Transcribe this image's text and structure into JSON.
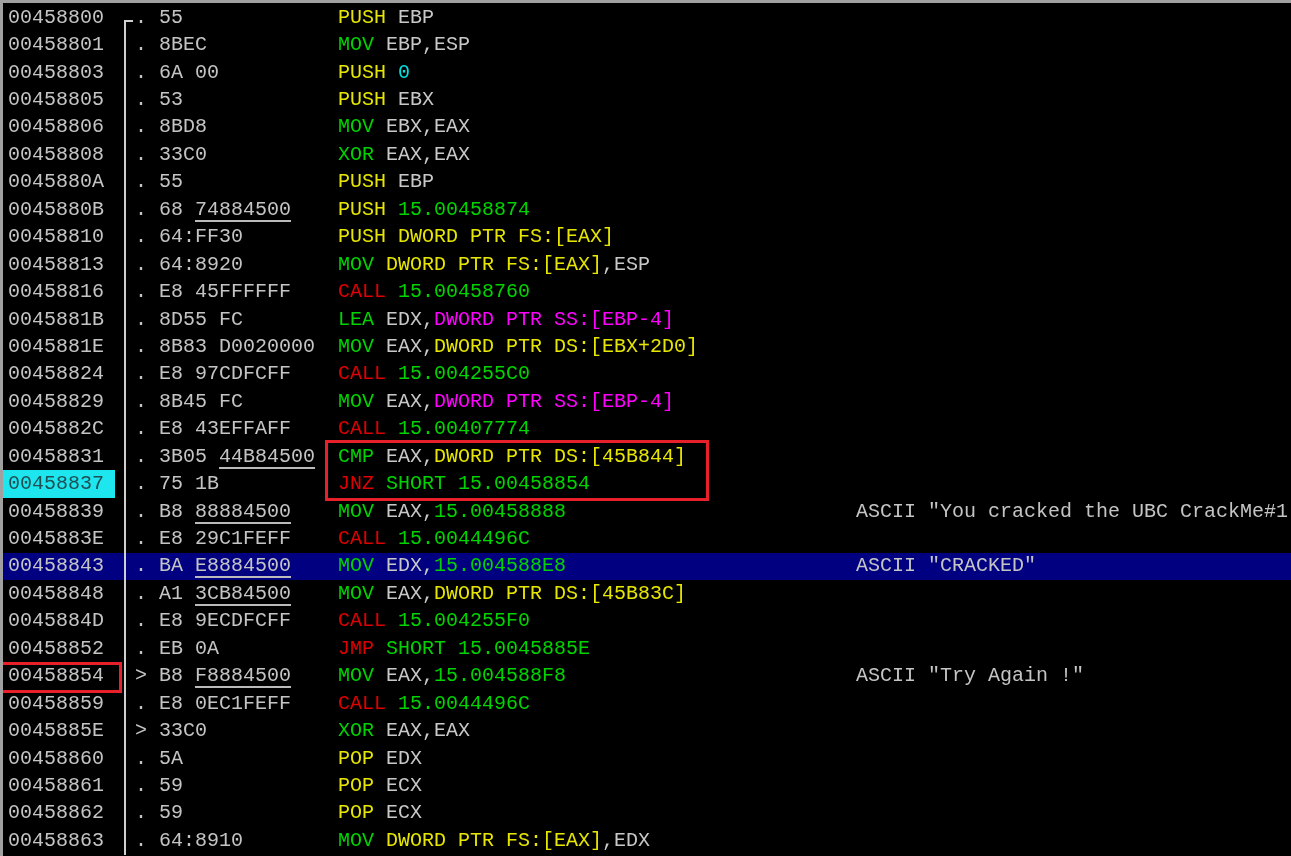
{
  "rows": [
    {
      "address": "00458800",
      "marker": ".",
      "hex": "55",
      "mnemonic": "PUSH",
      "kind": "push",
      "operands": [
        {
          "text": "EBP",
          "kind": "reg"
        }
      ],
      "selected": false,
      "current": false,
      "address_boxed": false,
      "asm_boxed": false
    },
    {
      "address": "00458801",
      "marker": ".",
      "hex": "8BEC",
      "mnemonic": "MOV",
      "kind": "move",
      "operands": [
        {
          "text": "EBP,ESP",
          "kind": "reg"
        }
      ],
      "selected": false,
      "current": false,
      "address_boxed": false,
      "asm_boxed": false
    },
    {
      "address": "00458803",
      "marker": ".",
      "hex": "6A 00",
      "mnemonic": "PUSH",
      "kind": "push",
      "operands": [
        {
          "text": "0",
          "kind": "imm"
        }
      ],
      "selected": false,
      "current": false,
      "address_boxed": false,
      "asm_boxed": false
    },
    {
      "address": "00458805",
      "marker": ".",
      "hex": "53",
      "mnemonic": "PUSH",
      "kind": "push",
      "operands": [
        {
          "text": "EBX",
          "kind": "reg"
        }
      ],
      "selected": false,
      "current": false,
      "address_boxed": false,
      "asm_boxed": false
    },
    {
      "address": "00458806",
      "marker": ".",
      "hex": "8BD8",
      "mnemonic": "MOV",
      "kind": "move",
      "operands": [
        {
          "text": "EBX,EAX",
          "kind": "reg"
        }
      ],
      "selected": false,
      "current": false,
      "address_boxed": false,
      "asm_boxed": false
    },
    {
      "address": "00458808",
      "marker": ".",
      "hex": "33C0",
      "mnemonic": "XOR",
      "kind": "move",
      "operands": [
        {
          "text": "EAX,EAX",
          "kind": "reg"
        }
      ],
      "selected": false,
      "current": false,
      "address_boxed": false,
      "asm_boxed": false
    },
    {
      "address": "0045880A",
      "marker": ".",
      "hex": "55",
      "mnemonic": "PUSH",
      "kind": "push",
      "operands": [
        {
          "text": "EBP",
          "kind": "reg"
        }
      ],
      "selected": false,
      "current": false,
      "address_boxed": false,
      "asm_boxed": false
    },
    {
      "address": "0045880B",
      "marker": ".",
      "hex": "68",
      "hex_ref": "74884500",
      "mnemonic": "PUSH",
      "kind": "push",
      "operands": [
        {
          "text": "15.00458874",
          "kind": "address"
        }
      ],
      "selected": false,
      "current": false,
      "address_boxed": false,
      "asm_boxed": false
    },
    {
      "address": "00458810",
      "marker": ".",
      "hex": "64:FF30",
      "mnemonic": "PUSH",
      "kind": "push",
      "operands": [
        {
          "text": "DWORD PTR FS:[EAX]",
          "kind": "mem"
        }
      ],
      "selected": false,
      "current": false,
      "address_boxed": false,
      "asm_boxed": false
    },
    {
      "address": "00458813",
      "marker": ".",
      "hex": "64:8920",
      "mnemonic": "MOV",
      "kind": "move",
      "operands": [
        {
          "text": "DWORD PTR FS:[EAX]",
          "kind": "mem"
        },
        {
          "text": ",ESP",
          "kind": "reg"
        }
      ],
      "selected": false,
      "current": false,
      "address_boxed": false,
      "asm_boxed": false
    },
    {
      "address": "00458816",
      "marker": ".",
      "hex": "E8 45FFFFFF",
      "mnemonic": "CALL",
      "kind": "call",
      "operands": [
        {
          "text": "15.00458760",
          "kind": "address"
        }
      ],
      "selected": false,
      "current": false,
      "address_boxed": false,
      "asm_boxed": false
    },
    {
      "address": "0045881B",
      "marker": ".",
      "hex": "8D55 FC",
      "mnemonic": "LEA",
      "kind": "move",
      "operands": [
        {
          "text": "EDX,",
          "kind": "reg"
        },
        {
          "text": "DWORD PTR SS:[EBP-4]",
          "kind": "stack"
        }
      ],
      "selected": false,
      "current": false,
      "address_boxed": false,
      "asm_boxed": false
    },
    {
      "address": "0045881E",
      "marker": ".",
      "hex": "8B83 D0020000",
      "mnemonic": "MOV",
      "kind": "move",
      "operands": [
        {
          "text": "EAX,",
          "kind": "reg"
        },
        {
          "text": "DWORD PTR DS:[EBX+2D0]",
          "kind": "mem"
        }
      ],
      "selected": false,
      "current": false,
      "address_boxed": false,
      "asm_boxed": false
    },
    {
      "address": "00458824",
      "marker": ".",
      "hex": "E8 97CDFCFF",
      "mnemonic": "CALL",
      "kind": "call",
      "operands": [
        {
          "text": "15.004255C0",
          "kind": "address"
        }
      ],
      "selected": false,
      "current": false,
      "address_boxed": false,
      "asm_boxed": false
    },
    {
      "address": "00458829",
      "marker": ".",
      "hex": "8B45 FC",
      "mnemonic": "MOV",
      "kind": "move",
      "operands": [
        {
          "text": "EAX,",
          "kind": "reg"
        },
        {
          "text": "DWORD PTR SS:[EBP-4]",
          "kind": "stack"
        }
      ],
      "selected": false,
      "current": false,
      "address_boxed": false,
      "asm_boxed": false
    },
    {
      "address": "0045882C",
      "marker": ".",
      "hex": "E8 43EFFAFF",
      "mnemonic": "CALL",
      "kind": "call",
      "operands": [
        {
          "text": "15.00407774",
          "kind": "address"
        }
      ],
      "selected": false,
      "current": false,
      "address_boxed": false,
      "asm_boxed": false
    },
    {
      "address": "00458831",
      "marker": ".",
      "hex": "3B05",
      "hex_ref": "44B84500",
      "mnemonic": "CMP",
      "kind": "move",
      "operands": [
        {
          "text": "EAX,",
          "kind": "reg"
        },
        {
          "text": "DWORD PTR DS:[45B844]",
          "kind": "mem"
        }
      ],
      "selected": false,
      "current": false,
      "address_boxed": false,
      "asm_boxed": true
    },
    {
      "address": "00458837",
      "marker": ".",
      "hex": "75 1B",
      "mnemonic": "JNZ",
      "kind": "call",
      "operands": [
        {
          "text": "SHORT 15.00458854",
          "kind": "address"
        }
      ],
      "selected": false,
      "current": true,
      "address_boxed": false,
      "asm_boxed": true
    },
    {
      "address": "00458839",
      "marker": ".",
      "hex": "B8",
      "hex_ref": "88884500",
      "mnemonic": "MOV",
      "kind": "move",
      "operands": [
        {
          "text": "EAX,",
          "kind": "reg"
        },
        {
          "text": "15.00458888",
          "kind": "address"
        }
      ],
      "comment": "ASCII \"You cracked the UBC CrackMe#1",
      "selected": false,
      "current": false,
      "address_boxed": false,
      "asm_boxed": false
    },
    {
      "address": "0045883E",
      "marker": ".",
      "hex": "E8 29C1FEFF",
      "mnemonic": "CALL",
      "kind": "call",
      "operands": [
        {
          "text": "15.0044496C",
          "kind": "address"
        }
      ],
      "selected": false,
      "current": false,
      "address_boxed": false,
      "asm_boxed": false
    },
    {
      "address": "00458843",
      "marker": ".",
      "hex": "BA",
      "hex_ref": "E8884500",
      "mnemonic": "MOV",
      "kind": "move",
      "operands": [
        {
          "text": "EDX,",
          "kind": "reg"
        },
        {
          "text": "15.004588E8",
          "kind": "address"
        }
      ],
      "comment": "ASCII \"CRACKED\"",
      "selected": true,
      "current": false,
      "address_boxed": false,
      "asm_boxed": false
    },
    {
      "address": "00458848",
      "marker": ".",
      "hex": "A1",
      "hex_ref": "3CB84500",
      "mnemonic": "MOV",
      "kind": "move",
      "operands": [
        {
          "text": "EAX,",
          "kind": "reg"
        },
        {
          "text": "DWORD PTR DS:[45B83C]",
          "kind": "mem"
        }
      ],
      "selected": false,
      "current": false,
      "address_boxed": false,
      "asm_boxed": false
    },
    {
      "address": "0045884D",
      "marker": ".",
      "hex": "E8 9ECDFCFF",
      "mnemonic": "CALL",
      "kind": "call",
      "operands": [
        {
          "text": "15.004255F0",
          "kind": "address"
        }
      ],
      "selected": false,
      "current": false,
      "address_boxed": false,
      "asm_boxed": false
    },
    {
      "address": "00458852",
      "marker": ".",
      "hex": "EB 0A",
      "mnemonic": "JMP",
      "kind": "call",
      "operands": [
        {
          "text": "SHORT 15.0045885E",
          "kind": "address"
        }
      ],
      "selected": false,
      "current": false,
      "address_boxed": false,
      "asm_boxed": false
    },
    {
      "address": "00458854",
      "marker": ">",
      "hex": "B8",
      "hex_ref": "F8884500",
      "mnemonic": "MOV",
      "kind": "move",
      "operands": [
        {
          "text": "EAX,",
          "kind": "reg"
        },
        {
          "text": "15.004588F8",
          "kind": "address"
        }
      ],
      "comment": "ASCII \"Try Again !\"",
      "selected": false,
      "current": false,
      "address_boxed": true,
      "asm_boxed": false
    },
    {
      "address": "00458859",
      "marker": ".",
      "hex": "E8 0EC1FEFF",
      "mnemonic": "CALL",
      "kind": "call",
      "operands": [
        {
          "text": "15.0044496C",
          "kind": "address"
        }
      ],
      "selected": false,
      "current": false,
      "address_boxed": false,
      "asm_boxed": false
    },
    {
      "address": "0045885E",
      "marker": ">",
      "hex": "33C0",
      "mnemonic": "XOR",
      "kind": "move",
      "operands": [
        {
          "text": "EAX,EAX",
          "kind": "reg"
        }
      ],
      "selected": false,
      "current": false,
      "address_boxed": false,
      "asm_boxed": false
    },
    {
      "address": "00458860",
      "marker": ".",
      "hex": "5A",
      "mnemonic": "POP",
      "kind": "push",
      "operands": [
        {
          "text": "EDX",
          "kind": "reg"
        }
      ],
      "selected": false,
      "current": false,
      "address_boxed": false,
      "asm_boxed": false
    },
    {
      "address": "00458861",
      "marker": ".",
      "hex": "59",
      "mnemonic": "POP",
      "kind": "push",
      "operands": [
        {
          "text": "ECX",
          "kind": "reg"
        }
      ],
      "selected": false,
      "current": false,
      "address_boxed": false,
      "asm_boxed": false
    },
    {
      "address": "00458862",
      "marker": ".",
      "hex": "59",
      "mnemonic": "POP",
      "kind": "push",
      "operands": [
        {
          "text": "ECX",
          "kind": "reg"
        }
      ],
      "selected": false,
      "current": false,
      "address_boxed": false,
      "asm_boxed": false
    },
    {
      "address": "00458863",
      "marker": ".",
      "hex": "64:8910",
      "mnemonic": "MOV",
      "kind": "move",
      "operands": [
        {
          "text": "DWORD PTR FS:[EAX]",
          "kind": "mem"
        },
        {
          "text": ",EDX",
          "kind": "reg"
        }
      ],
      "selected": false,
      "current": false,
      "address_boxed": false,
      "asm_boxed": false
    }
  ]
}
